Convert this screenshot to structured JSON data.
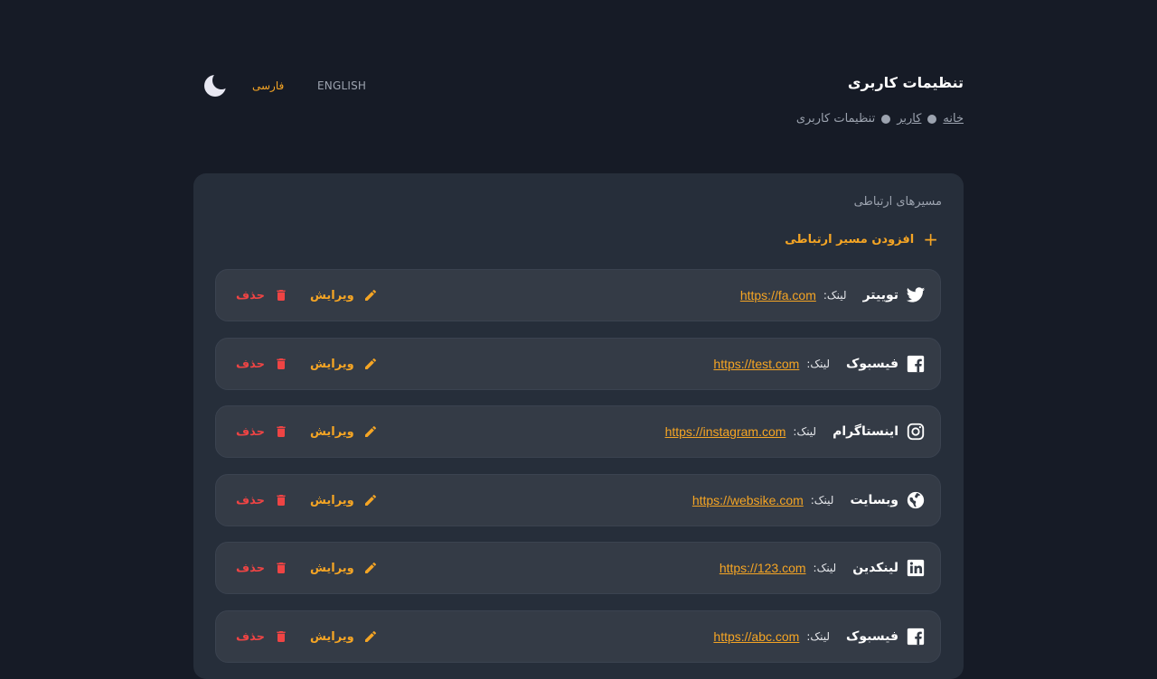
{
  "header": {
    "title": "تنظیمات کاربری",
    "breadcrumb": [
      "خانه",
      "کاربر",
      "تنظیمات کاربری"
    ],
    "lang_fa": "فارسی",
    "lang_en": "ENGLISH",
    "theme_icon": "moon-icon"
  },
  "colors": {
    "background": "#161b26",
    "card": "#262e3a",
    "row": "#343b46",
    "accent": "#f5a524",
    "danger": "#ef4444"
  },
  "section": {
    "title": "مسیرهای ارتباطی",
    "add_label": "افزودن مسیر ارتباطی",
    "link_label": "لینک:",
    "edit_label": "ویرایش",
    "delete_label": "حذف",
    "items": [
      {
        "name": "توییتر",
        "url": "https://fa.com",
        "icon": "twitter-icon"
      },
      {
        "name": "فیسبوک",
        "url": "https://test.com",
        "icon": "facebook-icon"
      },
      {
        "name": "اینستاگرام",
        "url": "https://instagram.com",
        "icon": "instagram-icon"
      },
      {
        "name": "وبسایت",
        "url": "https://websike.com",
        "icon": "globe-icon"
      },
      {
        "name": "لینکدین",
        "url": "https://123.com",
        "icon": "linkedin-icon"
      },
      {
        "name": "فیسبوک",
        "url": "https://abc.com",
        "icon": "facebook-icon"
      }
    ]
  }
}
